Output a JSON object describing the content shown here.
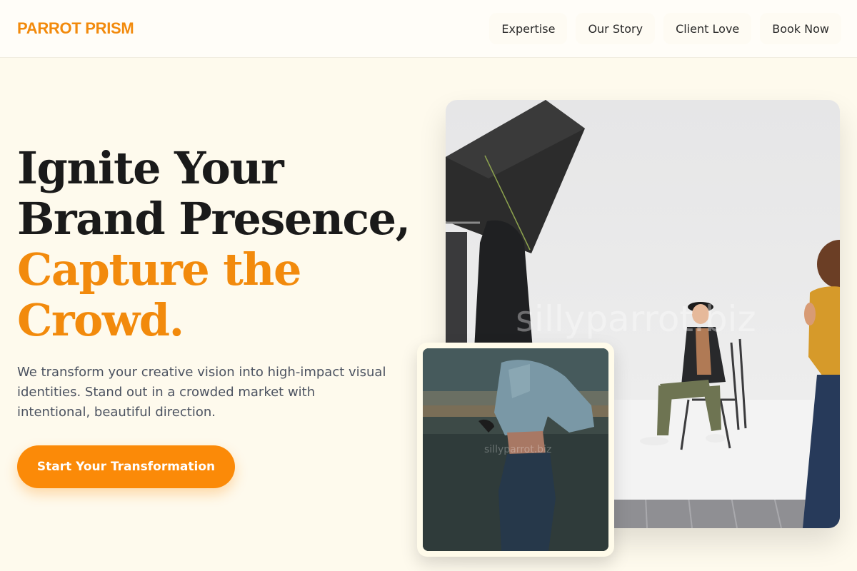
{
  "brand": {
    "name": "PARROT PRISM",
    "accent_color": "#f28a0c"
  },
  "nav": {
    "items": [
      {
        "label": "Expertise"
      },
      {
        "label": "Our Story"
      },
      {
        "label": "Client Love"
      },
      {
        "label": "Book Now"
      }
    ]
  },
  "hero": {
    "headline_line1": "Ignite Your",
    "headline_line2": "Brand Presence,",
    "headline_accent_line1": "Capture the",
    "headline_accent_line2": "Crowd.",
    "subtext": "We transform your creative vision into high-impact visual identities. Stand out in a crowded market with intentional, beautiful direction.",
    "cta_label": "Start Your Transformation",
    "cta_color": "#fb8a08"
  },
  "images": {
    "main_watermark": "sillyparrot.biz",
    "small_watermark": "sillyparrot.biz"
  }
}
